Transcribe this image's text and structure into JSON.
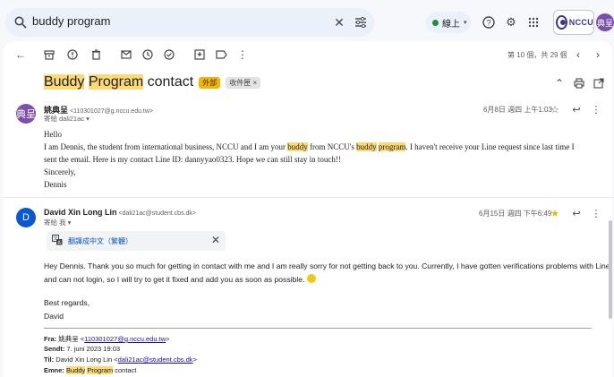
{
  "search": {
    "query": "buddy program"
  },
  "status": {
    "label": "線上"
  },
  "brand": {
    "word": "NCCU"
  },
  "me": {
    "initial": "典呈"
  },
  "pager": {
    "text": "第 10 個，共 29 個"
  },
  "subject": {
    "hl1": "Buddy",
    "sp1": " ",
    "hl2": "Program",
    "rest": " contact",
    "chip_a": "外部",
    "chip_b": "收件匣 ×"
  },
  "messages": [
    {
      "initial": "典呈",
      "avatar_color": "#7b4fb0",
      "name": "姚典呈",
      "address": "<110301027@g.nccu.edu.tw>",
      "to": "寄給 dali21ac ▾",
      "date": "6月8日 週四 上午1:03",
      "body": {
        "hello": "Hello",
        "p1a": "I am Dennis, the student from international business, NCCU and I am your ",
        "p1b": "buddy",
        "p1c": " from NCCU's ",
        "p1d": "buddy",
        "p1e": " ",
        "p1f": "program",
        "p1g": ". I haven't receive your Line request since last time I",
        "p2": "sent the email. Here is my contact Line ID: dannyyao0323. Hope we can still stay in touch!!",
        "p3": "Sincerely,",
        "p4": "Dennis"
      }
    },
    {
      "initial": "D",
      "avatar_color": "#0b57d0",
      "name": "David Xin Long Lin",
      "address": "<dali21ac@student.cbs.dk>",
      "to": "寄給 我 ▾",
      "date": "6月15日 週四 下午6:49",
      "translate": "翻譯成中文（繁體）",
      "body": {
        "l1": "Hey Dennis. Thank you so much for getting in contact with me and I am really sorry for not getting back to you. Currently, I have gotten verifications problems with Line",
        "l2": "and can not login, so I will try to get it fixed and add you as soon as possible.",
        "l3": "Best regards,",
        "l4": "David"
      },
      "quote": {
        "fra_label": "Fra:",
        "fra_name": " 姚典呈 <",
        "fra_addr": "110301027@g.nccu.edu.tw",
        "fra_end": ">",
        "sendt_label": "Sendt:",
        "sendt": " 7. juni 2023 19:03",
        "til_label": "Til:",
        "til_name": " David Xin Long Lin <",
        "til_addr": "dali21ac@student.cbs.dk",
        "til_end": ">",
        "emne_label": "Emne:",
        "emne_sp": " ",
        "emne_hl1": "Buddy",
        "emne_sp2": " ",
        "emne_hl2": "Program",
        "emne_rest": " contact"
      }
    }
  ]
}
